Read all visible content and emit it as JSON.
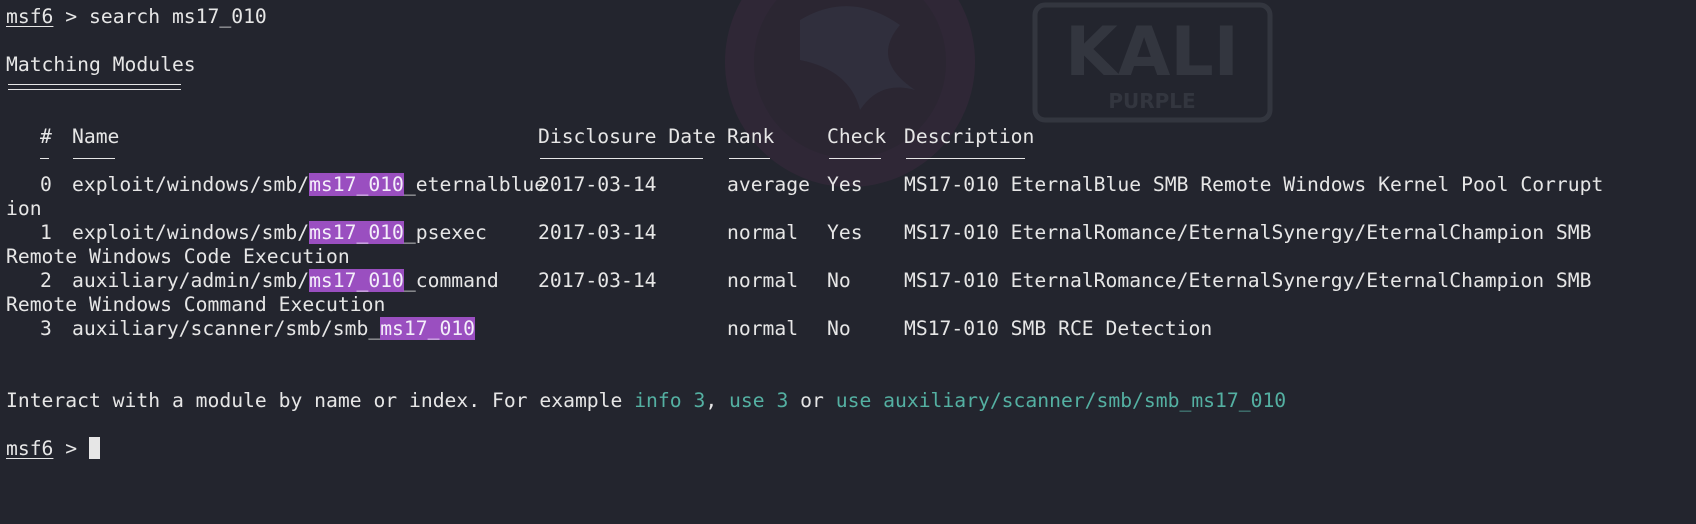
{
  "prompt": {
    "label": "msf6",
    "separator": " > "
  },
  "command": "search ms17_010",
  "matching_title": "Matching Modules",
  "columns": {
    "num": "#",
    "name": "Name",
    "date": "Disclosure Date",
    "rank": "Rank",
    "check": "Check",
    "desc": "Description"
  },
  "rows": [
    {
      "num": "0",
      "name_pre": "exploit/windows/smb/",
      "name_hl": "ms17_010",
      "name_post": "_eternalblue",
      "date": "2017-03-14",
      "rank": "average",
      "check": "Yes",
      "desc": "MS17-010 EternalBlue SMB Remote Windows Kernel Pool Corrupt",
      "desc_wrap": "ion"
    },
    {
      "num": "1",
      "name_pre": "exploit/windows/smb/",
      "name_hl": "ms17_010",
      "name_post": "_psexec",
      "date": "2017-03-14",
      "rank": "normal",
      "check": "Yes",
      "desc": "MS17-010 EternalRomance/EternalSynergy/EternalChampion SMB",
      "desc_wrap": "Remote Windows Code Execution"
    },
    {
      "num": "2",
      "name_pre": "auxiliary/admin/smb/",
      "name_hl": "ms17_010",
      "name_post": "_command",
      "date": "2017-03-14",
      "rank": "normal",
      "check": "No",
      "desc": "MS17-010 EternalRomance/EternalSynergy/EternalChampion SMB",
      "desc_wrap": "Remote Windows Command Execution"
    },
    {
      "num": "3",
      "name_pre": "auxiliary/scanner/smb/smb_",
      "name_hl": "ms17_010",
      "name_post": "",
      "date": "",
      "rank": "normal",
      "check": "No",
      "desc": "MS17-010 SMB RCE Detection",
      "desc_wrap": ""
    }
  ],
  "footer": {
    "text1": "Interact with a module by name or index. For example ",
    "cmd1": "info 3",
    "text2": ", ",
    "cmd2": "use 3",
    "text3": " or ",
    "cmd3": "use auxiliary/scanner/smb/smb_ms17_010"
  },
  "watermark": {
    "brand": "KALI",
    "sub": "PURPLE"
  },
  "colors": {
    "background": "#23252e",
    "text": "#e6e6e6",
    "highlight": "#9a4fc0",
    "link": "#54b0a2"
  }
}
